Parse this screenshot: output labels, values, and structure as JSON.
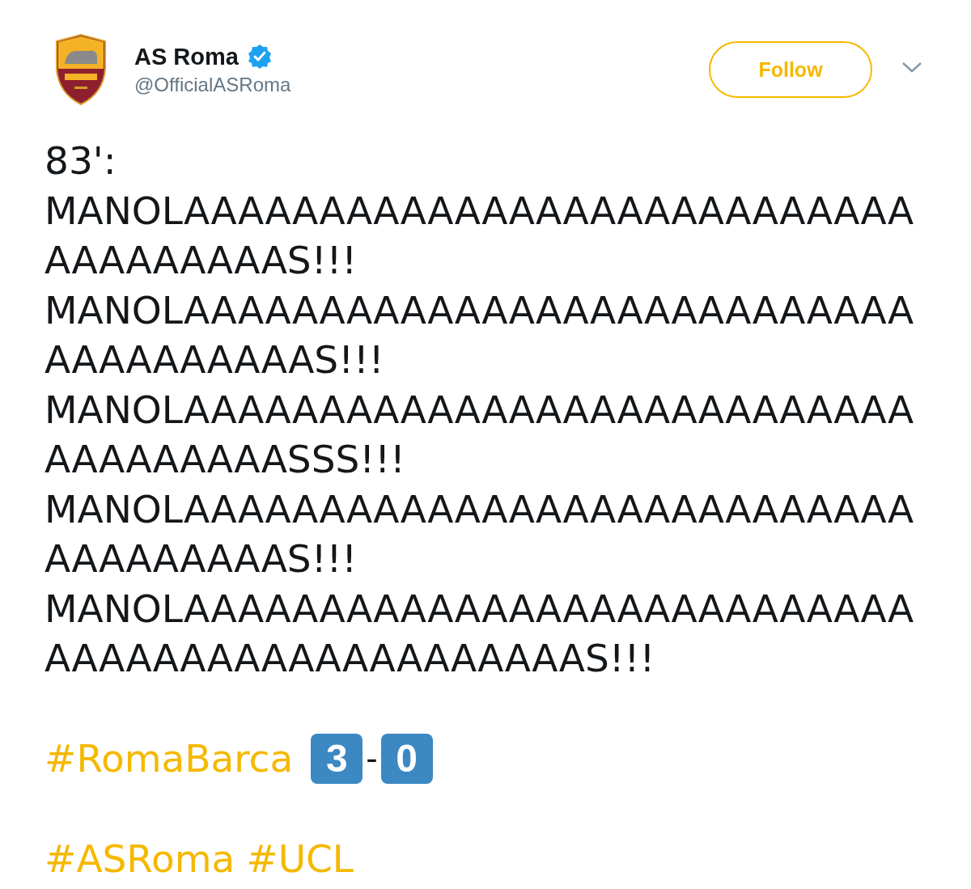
{
  "account": {
    "name": "AS Roma",
    "verified": true,
    "handle": "@OfficialASRoma"
  },
  "follow_button": {
    "label": "Follow"
  },
  "tweet_lines": [
    "83':",
    "MANOLAAAAAAAAAAAAAAAAAAAAAAAAAAA",
    "AAAAAAAAAS!!!",
    "MANOLAAAAAAAAAAAAAAAAAAAAAAAAAAA",
    "AAAAAAAAAAS!!!",
    "MANOLAAAAAAAAAAAAAAAAAAAAAAAAAAA",
    "AAAAAAAAASSS!!!",
    "MANOLAAAAAAAAAAAAAAAAAAAAAAAAAAA",
    "AAAAAAAAAS!!!",
    "MANOLAAAAAAAAAAAAAAAAAAAAAAAAAAA",
    "AAAAAAAAAAAAAAAAAAAAS!!!"
  ],
  "score_line": {
    "hashtag": "#RomaBarca",
    "home": "3",
    "separator": "-",
    "away": "0"
  },
  "hashtags": [
    "#ASRoma",
    "#UCL"
  ]
}
